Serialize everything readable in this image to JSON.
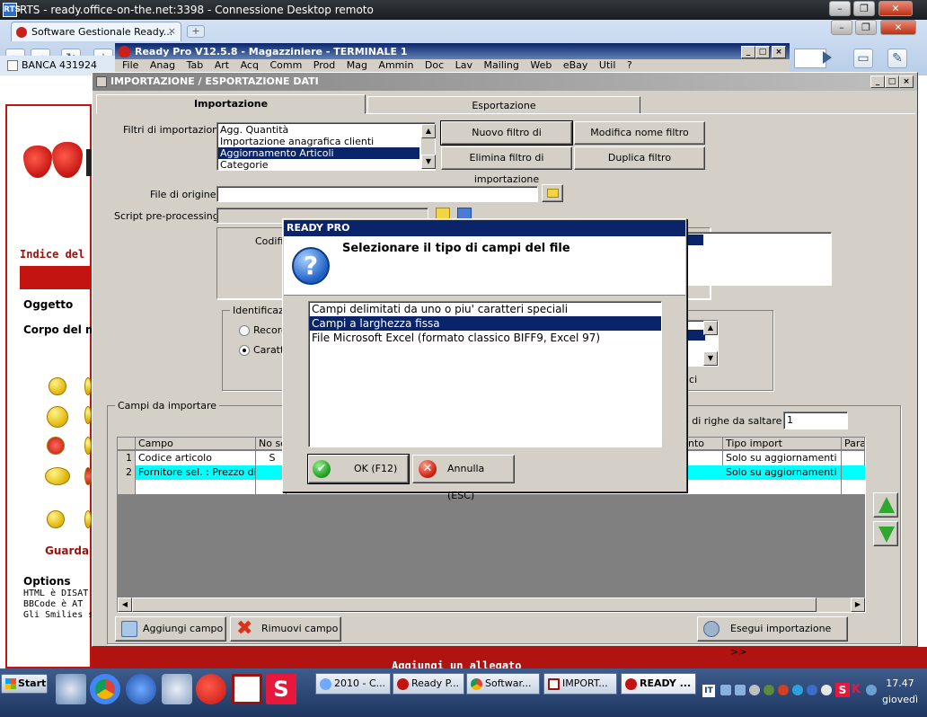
{
  "rdp": {
    "title": "RTS - ready.office-on-the.net:3398 - Connessione Desktop remoto",
    "logo": "RTS"
  },
  "browser": {
    "tab_title": "Software Gestionale Ready...",
    "tab_close": "×",
    "new_tab": "+",
    "bookmark": "BANCA 431924"
  },
  "forum": {
    "index_label": "Indice del fo",
    "subject_label": "Oggetto",
    "body_label": "Corpo del m",
    "guarda": "Guarda",
    "options_title": "Options",
    "html_line": "HTML è DISAT",
    "bbcode_line": "BBCode è AT",
    "smilies_line": "Gli Smilies so",
    "attach_label": "Aggiungi un allegato"
  },
  "readypro": {
    "title": "Ready Pro V12.5.8 - Magazziniere - TERMINALE 1",
    "menu": "File Anag Tab Art Acq Comm Prod Mag Ammin Doc Lav Mailing Web eBay Util ?"
  },
  "import_window": {
    "title": "IMPORTAZIONE / ESPORTAZIONE DATI",
    "tabs": [
      {
        "label": "Importazione"
      },
      {
        "label": "Esportazione"
      }
    ],
    "filters_label": "Filtri di importazione :",
    "filters": [
      {
        "label": "Agg. Quantità",
        "selected": false
      },
      {
        "label": "Importazione anagrafica clienti",
        "selected": false
      },
      {
        "label": "Aggiornamento Articoli",
        "selected": true
      },
      {
        "label": "Categorie",
        "selected": false
      }
    ],
    "btn_new_filter": "Nuovo filtro di importazione",
    "btn_rename_filter": "Modifica nome filtro",
    "btn_delete_filter": "Elimina filtro di importazione",
    "btn_duplicate_filter": "Duplica filtro",
    "source_file_label": "File di origine :",
    "source_file_value": "",
    "script_label": "Script pre-processing :",
    "coding_label": "Codific",
    "ident_group": "Identificazion",
    "radio_1": "Record",
    "radio_2": "Caratte",
    "right_partial": "ici",
    "fields_group": "Campi da importare",
    "skip_rows_label": "o di righe da saltare :",
    "skip_rows_value": "1",
    "grid_headers": [
      "",
      "Campo",
      "No se",
      "",
      "nto",
      "Tipo import",
      "Para"
    ],
    "grid_rows": [
      {
        "n": "1",
        "field": "Codice articolo",
        "nose": "S",
        "type": "Solo su aggiornamenti"
      },
      {
        "n": "2",
        "field": "Fornitore sel. : Prezzo di ...",
        "nose": "",
        "type": "Solo su aggiornamenti"
      }
    ],
    "btn_add_field": "Aggiungi campo",
    "btn_remove_field": "Rimuovi campo",
    "btn_run_import": "Esegui importazione >>"
  },
  "dialog": {
    "title": "READY PRO",
    "question": "Selezionare il tipo di campi del file",
    "options": [
      {
        "label": "Campi delimitati da uno o piu' caratteri speciali",
        "selected": false
      },
      {
        "label": "Campi a larghezza fissa",
        "selected": true
      },
      {
        "label": "File Microsoft Excel (formato classico BIFF9, Excel 97)",
        "selected": false
      }
    ],
    "ok_label": "OK (F12)",
    "cancel_label": "Annulla (ESC)"
  },
  "taskbar": {
    "start": "Start",
    "tasks": [
      {
        "label": "2010 - C...",
        "active": false
      },
      {
        "label": "Ready P...",
        "active": false
      },
      {
        "label": "Softwar...",
        "active": false
      },
      {
        "label": "IMPORT...",
        "active": false
      },
      {
        "label": "READY ...",
        "active": true
      }
    ],
    "clock_time": "17.47",
    "clock_day": "giovedì"
  },
  "colors": {
    "selection": "#0a246a",
    "cyan_row": "#00ffff",
    "forum_red": "#c41410"
  }
}
